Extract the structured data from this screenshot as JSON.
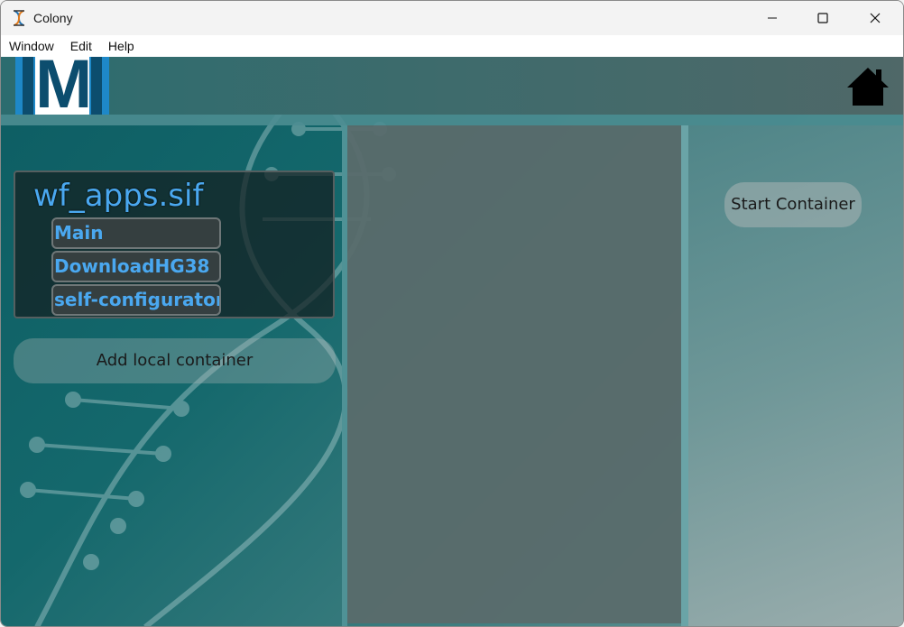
{
  "window": {
    "title": "Colony",
    "controls": {
      "minimize_icon": "minimize-icon",
      "maximize_icon": "maximize-icon",
      "close_icon": "close-icon"
    }
  },
  "menu": {
    "items": [
      {
        "label": "Window"
      },
      {
        "label": "Edit"
      },
      {
        "label": "Help"
      }
    ]
  },
  "header": {
    "logo_letter": "M",
    "home_icon": "home-icon"
  },
  "containers": [
    {
      "name": "wf_apps.sif",
      "apps": [
        {
          "label": "Main"
        },
        {
          "label": "DownloadHG38"
        },
        {
          "label": "self-configurator"
        }
      ]
    }
  ],
  "left_panel": {
    "add_label": "Add local container"
  },
  "right_panel": {
    "start_label": "Start Container"
  },
  "colors": {
    "accent_text": "#4aa8f0",
    "logo_blue": "#1e88c8",
    "logo_dark": "#0c4d6e"
  }
}
